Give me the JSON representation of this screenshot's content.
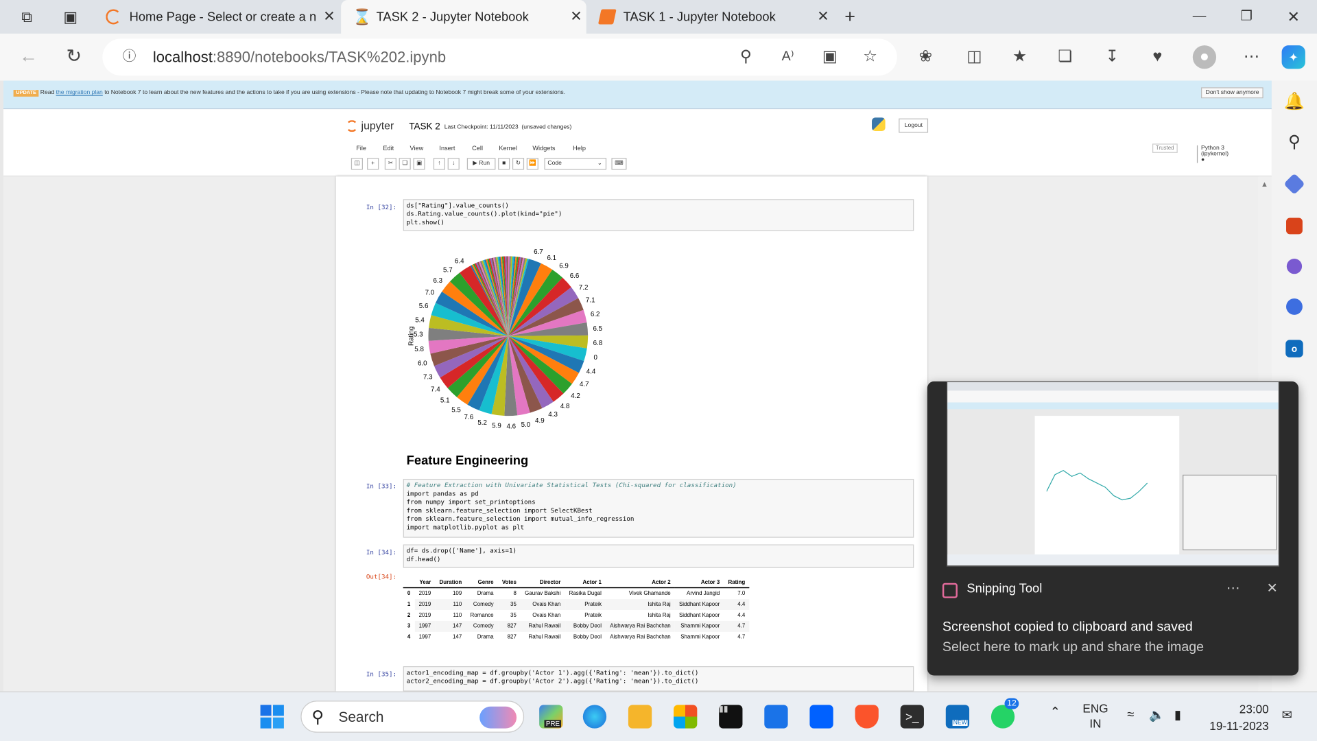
{
  "browser": {
    "tabs": [
      {
        "title": "Home Page - Select or create a n",
        "active": false
      },
      {
        "title": "TASK 2 - Jupyter Notebook",
        "active": true
      },
      {
        "title": "TASK 1 - Jupyter Notebook",
        "active": false
      }
    ],
    "url_host": "localhost",
    "url_rest": ":8890/notebooks/TASK%202.ipynb"
  },
  "banner": {
    "tag": "UPDATE",
    "pre": "Read ",
    "link": "the migration plan",
    "post": " to Notebook 7 to learn about the new features and the actions to take if you are using extensions - Please note that updating to Notebook 7 might break some of your extensions.",
    "dismiss": "Don't show anymore"
  },
  "jupyter": {
    "logo": "jupyter",
    "title": "TASK 2",
    "checkpoint": "Last Checkpoint: 11/11/2023",
    "unsaved": "(unsaved changes)",
    "logout": "Logout",
    "menu": [
      "File",
      "Edit",
      "View",
      "Insert",
      "Cell",
      "Kernel",
      "Widgets",
      "Help"
    ],
    "trusted": "Trusted",
    "kernel": "Python 3 (ipykernel)",
    "run_label": "Run",
    "celltype": "Code"
  },
  "cells": {
    "c32": {
      "prompt": "In [32]:",
      "lines": [
        "ds[\"Rating\"].value_counts()",
        "ds.Rating.value_counts().plot(kind=\"pie\")",
        "plt.show()"
      ]
    },
    "heading": "Feature Engineering",
    "c33": {
      "prompt": "In [33]:",
      "lines": [
        "# Feature Extraction with Univariate Statistical Tests (Chi-squared for classification)",
        "import pandas as pd",
        "from numpy import set_printoptions",
        "from sklearn.feature_selection import SelectKBest",
        "from sklearn.feature_selection import mutual_info_regression",
        "import matplotlib.pyplot as plt"
      ]
    },
    "c34": {
      "prompt": "In [34]:",
      "out_prompt": "Out[34]:",
      "lines": [
        "df= ds.drop(['Name'], axis=1)",
        "df.head()"
      ]
    },
    "c35": {
      "prompt": "In [35]:",
      "lines": [
        "actor1_encoding_map = df.groupby('Actor 1').agg({'Rating': 'mean'}).to_dict()",
        "actor2_encoding_map = df.groupby('Actor 2').agg({'Rating': 'mean'}).to_dict()"
      ]
    }
  },
  "table": {
    "columns": [
      "",
      "Year",
      "Duration",
      "Genre",
      "Votes",
      "Director",
      "Actor 1",
      "Actor 2",
      "Actor 3",
      "Rating"
    ],
    "rows": [
      [
        "0",
        "2019",
        "109",
        "Drama",
        "8",
        "Gaurav Bakshi",
        "Rasika Dugal",
        "Vivek Ghamande",
        "Arvind Jangid",
        "7.0"
      ],
      [
        "1",
        "2019",
        "110",
        "Comedy",
        "35",
        "Ovais Khan",
        "Prateik",
        "Ishita Raj",
        "Siddhant Kapoor",
        "4.4"
      ],
      [
        "2",
        "2019",
        "110",
        "Romance",
        "35",
        "Ovais Khan",
        "Prateik",
        "Ishita Raj",
        "Siddhant Kapoor",
        "4.4"
      ],
      [
        "3",
        "1997",
        "147",
        "Comedy",
        "827",
        "Rahul Rawail",
        "Bobby Deol",
        "Aishwarya Rai Bachchan",
        "Shammi Kapoor",
        "4.7"
      ],
      [
        "4",
        "1997",
        "147",
        "Drama",
        "827",
        "Rahul Rawail",
        "Bobby Deol",
        "Aishwarya Rai Bachchan",
        "Shammi Kapoor",
        "4.7"
      ]
    ]
  },
  "chart_data": {
    "type": "pie",
    "ylabel": "Rating",
    "slice_labels": [
      "6.7",
      "6.1",
      "6.9",
      "6.6",
      "7.2",
      "7.1",
      "6.2",
      "6.5",
      "6.8",
      "0",
      "4.4",
      "4.7",
      "4.2",
      "4.8",
      "4.3",
      "4.9",
      "5.0",
      "4.6",
      "5.9",
      "5.2",
      "7.6",
      "5.5",
      "5.1",
      "7.4",
      "7.3",
      "6.0",
      "5.8",
      "5.3",
      "5.4",
      "5.6",
      "7.0",
      "6.3",
      "5.7",
      "6.4"
    ],
    "colors": [
      "#1f77b4",
      "#ff7f0e",
      "#2ca02c",
      "#d62728",
      "#9467bd",
      "#8c564b",
      "#e377c2",
      "#7f7f7f",
      "#bcbd22",
      "#17becf"
    ]
  },
  "toast": {
    "app": "Snipping Tool",
    "line1": "Screenshot copied to clipboard and saved",
    "line2": "Select here to mark up and share the image"
  },
  "taskbar": {
    "search": "Search",
    "lang1": "ENG",
    "lang2": "IN",
    "time": "23:00",
    "date": "19-11-2023",
    "whatsapp_badge": "12",
    "pre_badge": "PRE",
    "new_badge": "NEW"
  }
}
